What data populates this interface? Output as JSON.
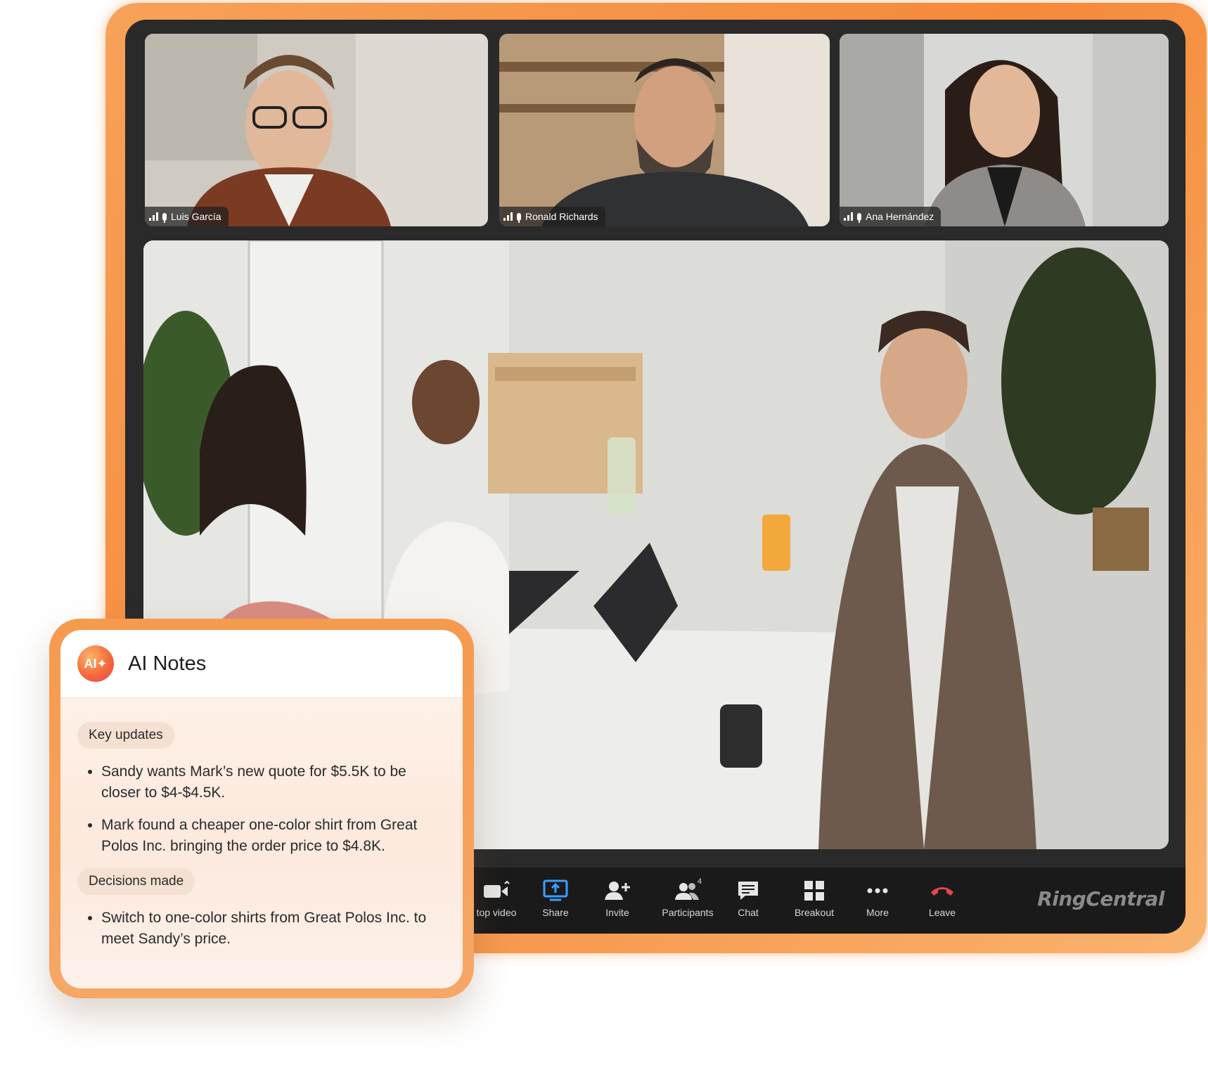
{
  "participants": [
    {
      "name": "Luis García"
    },
    {
      "name": "Ronald Richards"
    },
    {
      "name": "Ana Hernández"
    }
  ],
  "toolbar": {
    "stop_video": "top video",
    "share": "Share",
    "invite": "Invite",
    "participants": "Participants",
    "participants_count": "4",
    "chat": "Chat",
    "breakout": "Breakout",
    "more": "More",
    "leave": "Leave",
    "brand": "RingCentral"
  },
  "ai_notes": {
    "badge": "AI✦",
    "title": "AI Notes",
    "sections": [
      {
        "heading": "Key updates",
        "items": [
          "Sandy wants Mark’s new quote for $5.5K to be closer to $4-$4.5K.",
          "Mark found a cheaper one-color shirt from Great Polos Inc. bringing the order price to $4.8K."
        ]
      },
      {
        "heading": "Decisions made",
        "items": [
          "Switch to one-color shirts from Great Polos Inc. to meet Sandy’s price."
        ]
      }
    ]
  },
  "colors": {
    "frame_orange": "#f58a3a",
    "share_blue": "#3aa0ff",
    "leave_red": "#e5484d"
  }
}
